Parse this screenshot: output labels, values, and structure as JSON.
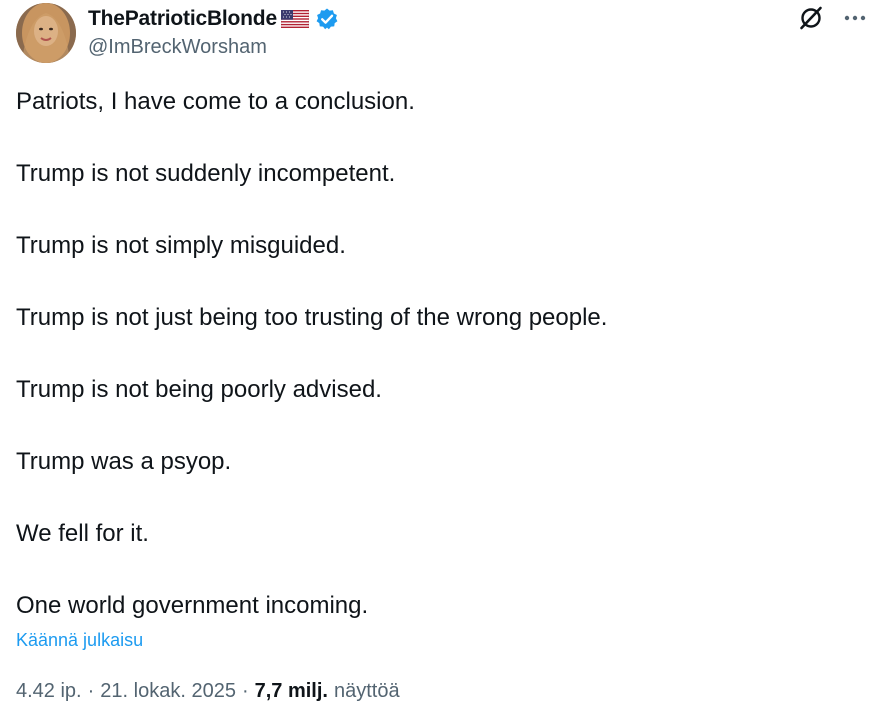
{
  "author": {
    "display_name": "ThePatrioticBlonde",
    "handle": "@ImBreckWorsham",
    "flag_icon": "us-flag-icon",
    "verified_icon": "verified-badge-icon",
    "verified_color": "#1d9bf0"
  },
  "actions": {
    "grok_icon": "grok-icon",
    "more_icon": "more-options-icon"
  },
  "post": {
    "paragraphs": [
      "Patriots, I have come to a conclusion.",
      "Trump is not suddenly incompetent.",
      "Trump is not simply misguided.",
      "Trump is not just being too trusting of the wrong people.",
      "Trump is not being poorly advised.",
      "Trump was a psyop.",
      "We fell for it.",
      "One world government incoming."
    ],
    "translate_label": "Käännä julkaisu"
  },
  "meta": {
    "time": "4.42 ip.",
    "separator": "·",
    "date": "21. lokak. 2025",
    "views_count": "7,7 milj.",
    "views_label": "näyttöä"
  },
  "colors": {
    "text": "#0f1419",
    "secondary": "#536471",
    "link": "#1d9bf0"
  }
}
